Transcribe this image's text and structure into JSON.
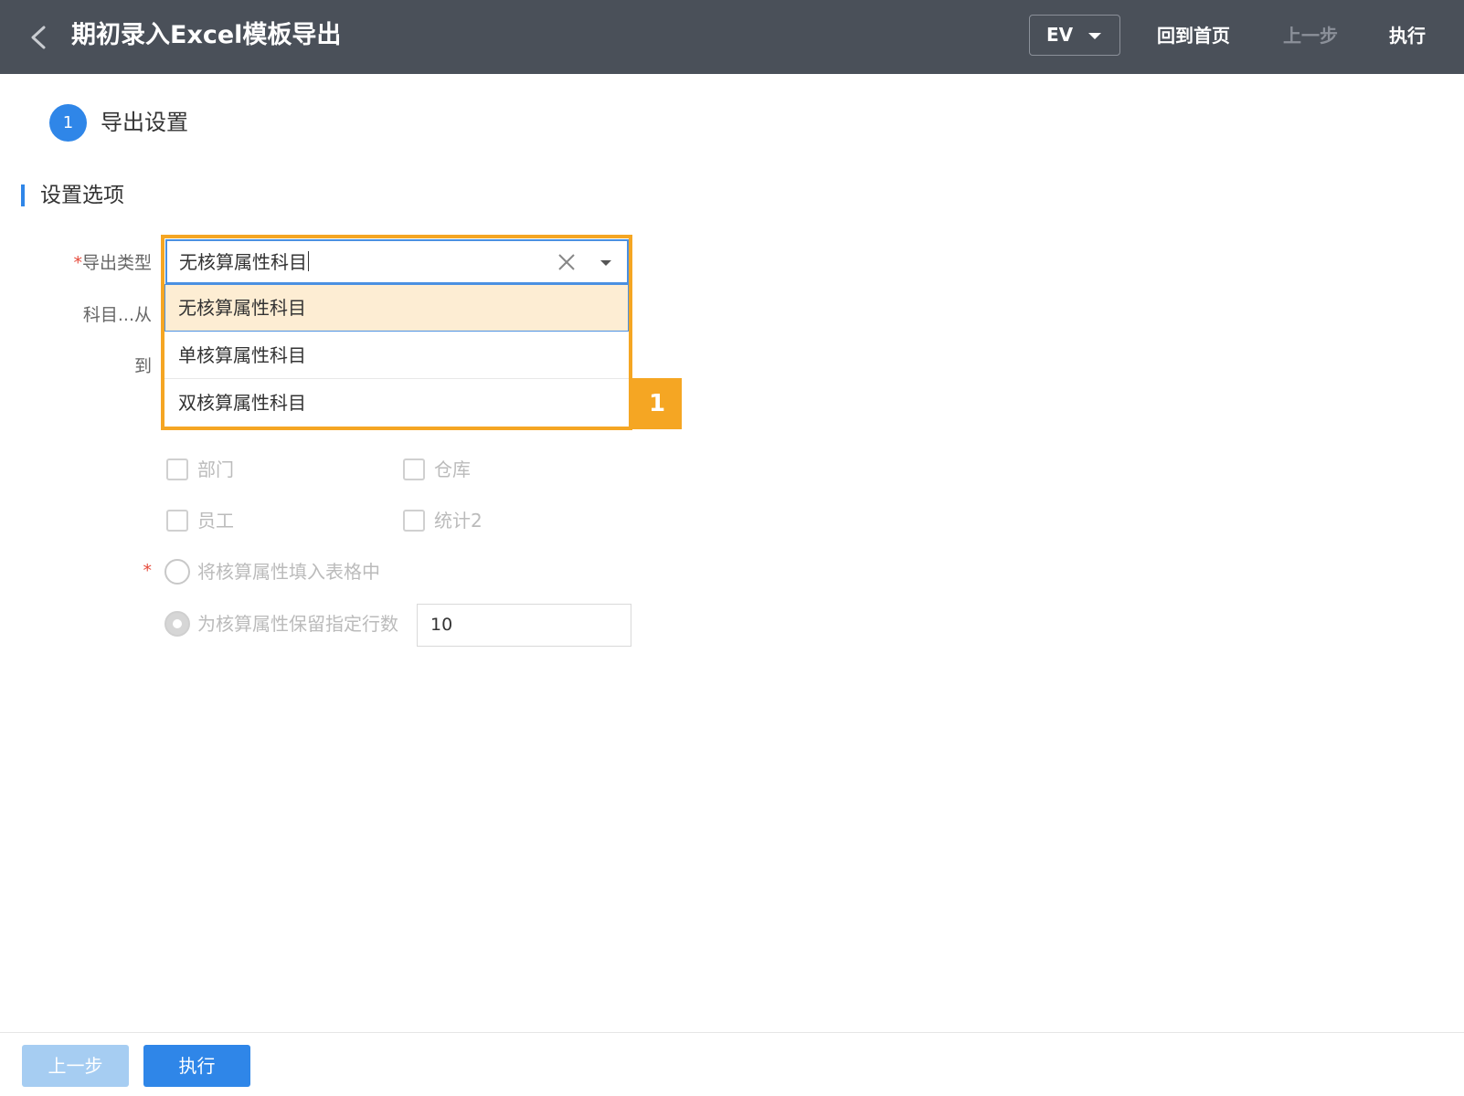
{
  "header": {
    "title": "期初录入Excel模板导出",
    "ev_value": "EV",
    "home_label": "回到首页",
    "prev_label": "上一步",
    "exec_label": "执行"
  },
  "step": {
    "number": "1",
    "label": "导出设置"
  },
  "section": {
    "title": "设置选项"
  },
  "form": {
    "export_type_label": "导出类型",
    "required_mark": "*",
    "export_type_value": "无核算属性科目",
    "from_label": "科目...从",
    "to_label": "到",
    "options": [
      "无核算属性科目",
      "单核算属性科目",
      "双核算属性科目"
    ],
    "checkboxes": [
      "部门",
      "仓库",
      "员工",
      "统计2"
    ],
    "radio_fill": "将核算属性填入表格中",
    "radio_reserve": "为核算属性保留指定行数",
    "rows_value": "10"
  },
  "callout": {
    "number": "1"
  },
  "footer": {
    "prev_label": "上一步",
    "exec_label": "执行"
  },
  "colors": {
    "header_bg": "#4a5059",
    "primary": "#2f86e8",
    "highlight": "#f5a623",
    "selected_option_bg": "#fdedd3"
  }
}
